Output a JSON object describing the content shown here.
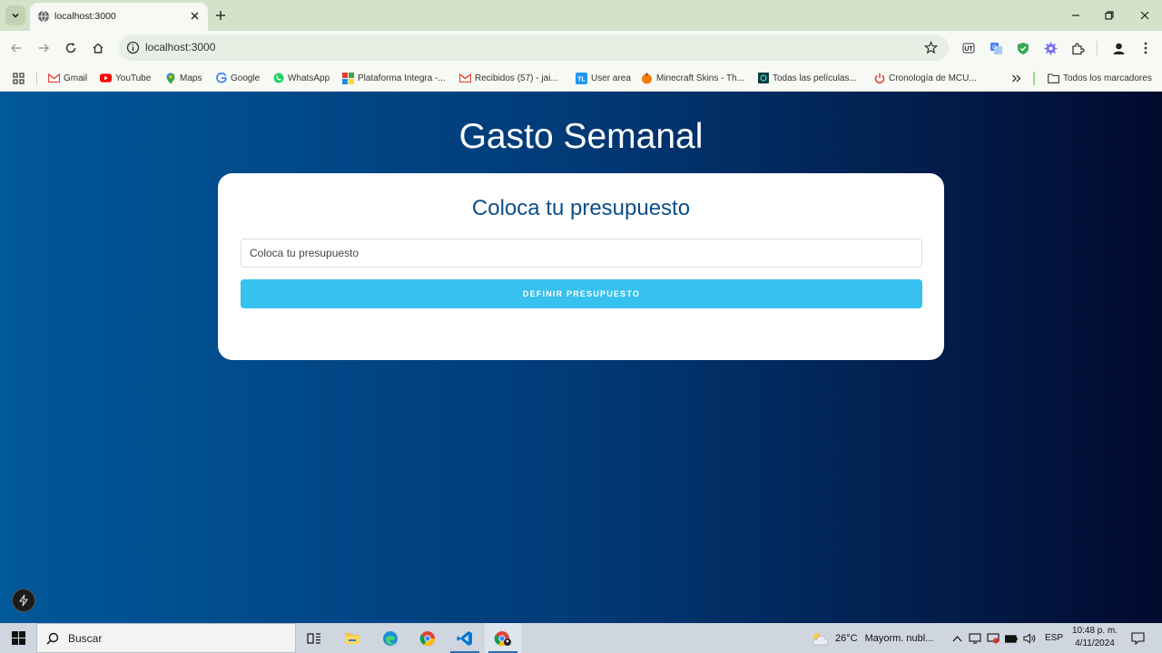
{
  "browser": {
    "tab_title": "localhost:3000",
    "url": "localhost:3000"
  },
  "bookmarks": [
    {
      "label": "Gmail",
      "icon": "gmail-icon"
    },
    {
      "label": "YouTube",
      "icon": "youtube-icon"
    },
    {
      "label": "Maps",
      "icon": "maps-icon"
    },
    {
      "label": "Google",
      "icon": "google-icon"
    },
    {
      "label": "WhatsApp",
      "icon": "whatsapp-icon"
    },
    {
      "label": "Plataforma Integra -...",
      "icon": "integra-icon"
    },
    {
      "label": "Recibidos (57) - jai...",
      "icon": "gmail-icon"
    },
    {
      "label": "User area",
      "icon": "tl-icon"
    },
    {
      "label": "Minecraft Skins - Th...",
      "icon": "minecraft-icon"
    },
    {
      "label": "Todas las películas...",
      "icon": "movies-icon"
    },
    {
      "label": "Cronología de MCU...",
      "icon": "power-icon"
    }
  ],
  "bookmarks_folder": "Todos los marcadores",
  "app": {
    "title": "Gasto Semanal",
    "card_heading": "Coloca tu presupuesto",
    "input_placeholder": "Coloca tu presupuesto",
    "input_value": "",
    "submit_label": "DEFINIR PRESUPUESTO"
  },
  "taskbar": {
    "search_placeholder": "Buscar",
    "weather_temp": "26°C",
    "weather_text": "Mayorm. nubl...",
    "language": "ESP",
    "time": "10:48 p. m.",
    "date": "4/11/2024"
  },
  "colors": {
    "page_gradient_start": "#01589a",
    "page_gradient_end": "#020a2e",
    "heading_blue": "#0b4f8a",
    "button_cyan": "#36c1ee",
    "chrome_frame": "#d3e3c9"
  }
}
